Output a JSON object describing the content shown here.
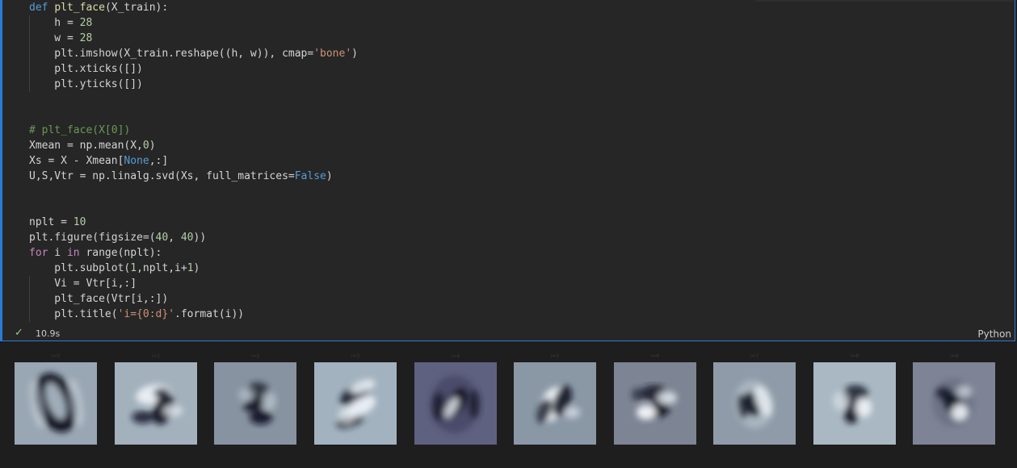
{
  "editor": {
    "language": "Python",
    "exec_time": "10.9s",
    "status_icon": "check-icon",
    "code_lines": [
      [
        [
          "kw",
          "def"
        ],
        [
          "plain",
          " "
        ],
        [
          "fn",
          "plt_face"
        ],
        [
          "plain",
          "(X_train):"
        ]
      ],
      [
        [
          "plain",
          "    h = "
        ],
        [
          "num",
          "28"
        ]
      ],
      [
        [
          "plain",
          "    w = "
        ],
        [
          "num",
          "28"
        ]
      ],
      [
        [
          "plain",
          "    plt.imshow(X_train.reshape((h, w)), cmap="
        ],
        [
          "str",
          "'bone'"
        ],
        [
          "plain",
          ")"
        ]
      ],
      [
        [
          "plain",
          "    plt.xticks([])"
        ]
      ],
      [
        [
          "plain",
          "    plt.yticks([])"
        ]
      ],
      [],
      [],
      [
        [
          "cmt",
          "# plt_face(X[0])"
        ]
      ],
      [
        [
          "plain",
          "Xmean = np.mean(X,"
        ],
        [
          "num",
          "0"
        ],
        [
          "plain",
          ")"
        ]
      ],
      [
        [
          "plain",
          "Xs = X - Xmean["
        ],
        [
          "bool",
          "None"
        ],
        [
          "plain",
          ",:]"
        ]
      ],
      [
        [
          "plain",
          "U,S,Vtr = np.linalg.svd(Xs, full_matrices="
        ],
        [
          "bool",
          "False"
        ],
        [
          "plain",
          ")"
        ]
      ],
      [],
      [],
      [
        [
          "plain",
          "nplt = "
        ],
        [
          "num",
          "10"
        ]
      ],
      [
        [
          "plain",
          "plt.figure(figsize=("
        ],
        [
          "num",
          "40"
        ],
        [
          "plain",
          ", "
        ],
        [
          "num",
          "40"
        ],
        [
          "plain",
          "))"
        ]
      ],
      [
        [
          "ctrl",
          "for"
        ],
        [
          "plain",
          " i "
        ],
        [
          "ctrl",
          "in"
        ],
        [
          "plain",
          " range(nplt):"
        ]
      ],
      [
        [
          "plain",
          "    plt.subplot("
        ],
        [
          "num",
          "1"
        ],
        [
          "plain",
          ",nplt,i+"
        ],
        [
          "num",
          "1"
        ],
        [
          "plain",
          ")"
        ]
      ],
      [
        [
          "plain",
          "    Vi = Vtr[i,:]"
        ]
      ],
      [
        [
          "plain",
          "    plt_face(Vtr[i,:])"
        ]
      ],
      [
        [
          "plain",
          "    plt.title("
        ],
        [
          "str",
          "'i={0:d}'"
        ],
        [
          "plain",
          ".format(i))"
        ]
      ]
    ]
  },
  "output": {
    "panels": [
      {
        "title": "i=0",
        "bg": "#99a6b3"
      },
      {
        "title": "i=1",
        "bg": "#a3b1bd"
      },
      {
        "title": "i=2",
        "bg": "#8793a0"
      },
      {
        "title": "i=3",
        "bg": "#a2b2bf"
      },
      {
        "title": "i=4",
        "bg": "#5f6180"
      },
      {
        "title": "i=5",
        "bg": "#8a98a6"
      },
      {
        "title": "i=6",
        "bg": "#7d8594"
      },
      {
        "title": "i=7",
        "bg": "#8f9ba8"
      },
      {
        "title": "i=8",
        "bg": "#a9b8c3"
      },
      {
        "title": "i=9",
        "bg": "#7e8495"
      }
    ]
  }
}
